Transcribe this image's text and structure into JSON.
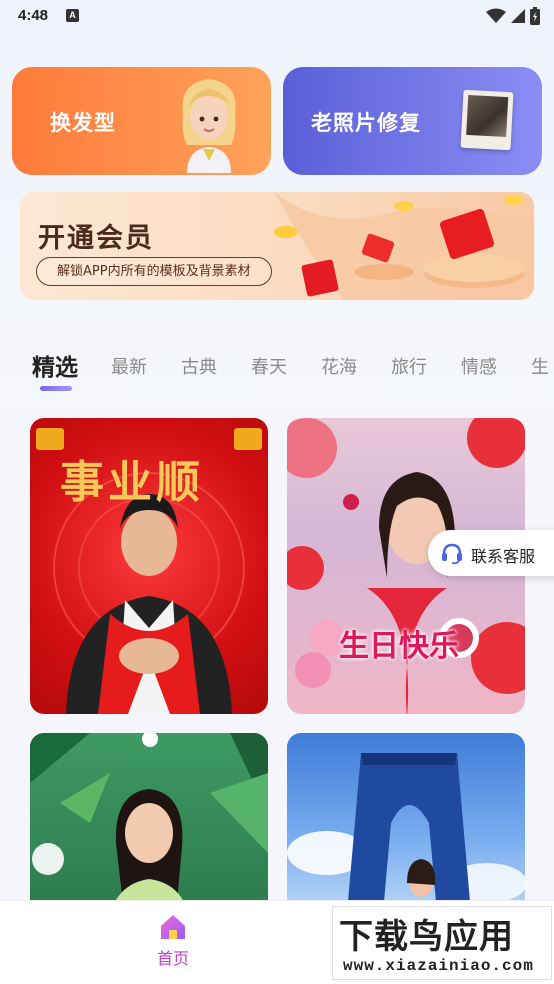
{
  "status_bar": {
    "time": "4:48",
    "notif_glyph": "A"
  },
  "features": [
    {
      "label": "换发型",
      "icon": "cartoon-girl-avatar"
    },
    {
      "label": "老照片修复",
      "icon": "old-photo"
    }
  ],
  "vip": {
    "title": "开通会员",
    "subtitle": "解锁APP内所有的模板及背景素材"
  },
  "tabs": [
    "精选",
    "最新",
    "古典",
    "春天",
    "花海",
    "旅行",
    "情感",
    "生"
  ],
  "active_tab": 0,
  "grid": {
    "card1_text": "事业顺",
    "card2_text": "生日快乐"
  },
  "customer_service": {
    "label": "联系客服"
  },
  "bottom_nav": {
    "home_label": "首页"
  },
  "watermark": {
    "title": "下载鸟应用",
    "url": "www.xiazainiao.com"
  },
  "colors": {
    "hair_card": "#ff7a3a",
    "photo_card": "#5a5fd8",
    "accent_purple": "#c23cd6",
    "tab_indicator": "#7a6af0"
  }
}
